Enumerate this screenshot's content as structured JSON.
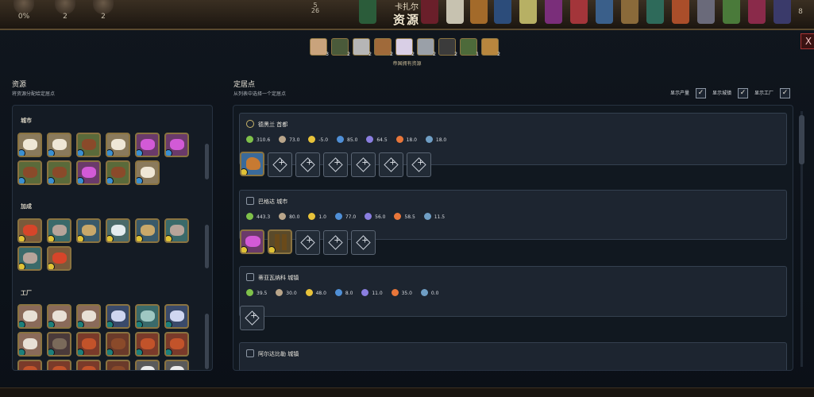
{
  "top_bar": {
    "civ_name": "卡扎尔",
    "screen_title": "资源",
    "stats": [
      {
        "value": "0%",
        "icon": "science-progress-icon"
      },
      {
        "value": "2",
        "icon": "culture-icon"
      },
      {
        "value": "2",
        "icon": "faith-icon"
      },
      {
        "value": "5",
        "icon": "city-count-icon"
      },
      {
        "value": "26",
        "icon": "population-icon"
      },
      {
        "value": "8",
        "icon": "unit-icon"
      }
    ],
    "close_label": "X"
  },
  "empire": {
    "label": "帝国拥有资源",
    "counts": [
      "3",
      "2",
      "2",
      "2",
      "2",
      "2",
      "2",
      "1",
      "2"
    ],
    "colors": [
      "#c9a37c",
      "#4a5a3a",
      "#b6b6b6",
      "#a06a3a",
      "#d9cfe6",
      "#9aa0a8",
      "#3b3b3b",
      "#4d6a3a",
      "#b8863e"
    ]
  },
  "left_panel": {
    "title": "资源",
    "subtitle": "将资源分配给定居点",
    "sections": [
      {
        "title": "城市"
      },
      {
        "title": "加成"
      },
      {
        "title": "工厂"
      }
    ]
  },
  "right_panel": {
    "title": "定居点",
    "subtitle": "从列表中选择一个定居点",
    "toggles": [
      {
        "label": "显示产量",
        "checked": "✓"
      },
      {
        "label": "显示城镇",
        "checked": "✓"
      },
      {
        "label": "显示工厂",
        "checked": "✓"
      }
    ],
    "settlements": [
      {
        "name": "德黑兰 首都",
        "yields": [
          "310.6",
          "73.0",
          "-5.0",
          "85.0",
          "64.5",
          "18.0",
          "18.0"
        ]
      },
      {
        "name": "巴格达 城市",
        "yields": [
          "443.3",
          "80.0",
          "1.0",
          "77.0",
          "56.0",
          "58.5",
          "11.5"
        ]
      },
      {
        "name": "蒂亚瓦纳科 城镇",
        "yields": [
          "39.5",
          "30.0",
          "48.0",
          "8.0",
          "11.0",
          "35.0",
          "0.0"
        ]
      },
      {
        "name": "阿尔达比勒 城镇",
        "yields": []
      }
    ]
  },
  "colors": {
    "food": "#7fc14a",
    "production": "#b9a58a",
    "gold": "#e8c33a",
    "science": "#4f8fd6",
    "culture": "#8a7ee0",
    "happiness": "#e8763a",
    "influence": "#6f9ec4",
    "frame": "#8a7340"
  }
}
